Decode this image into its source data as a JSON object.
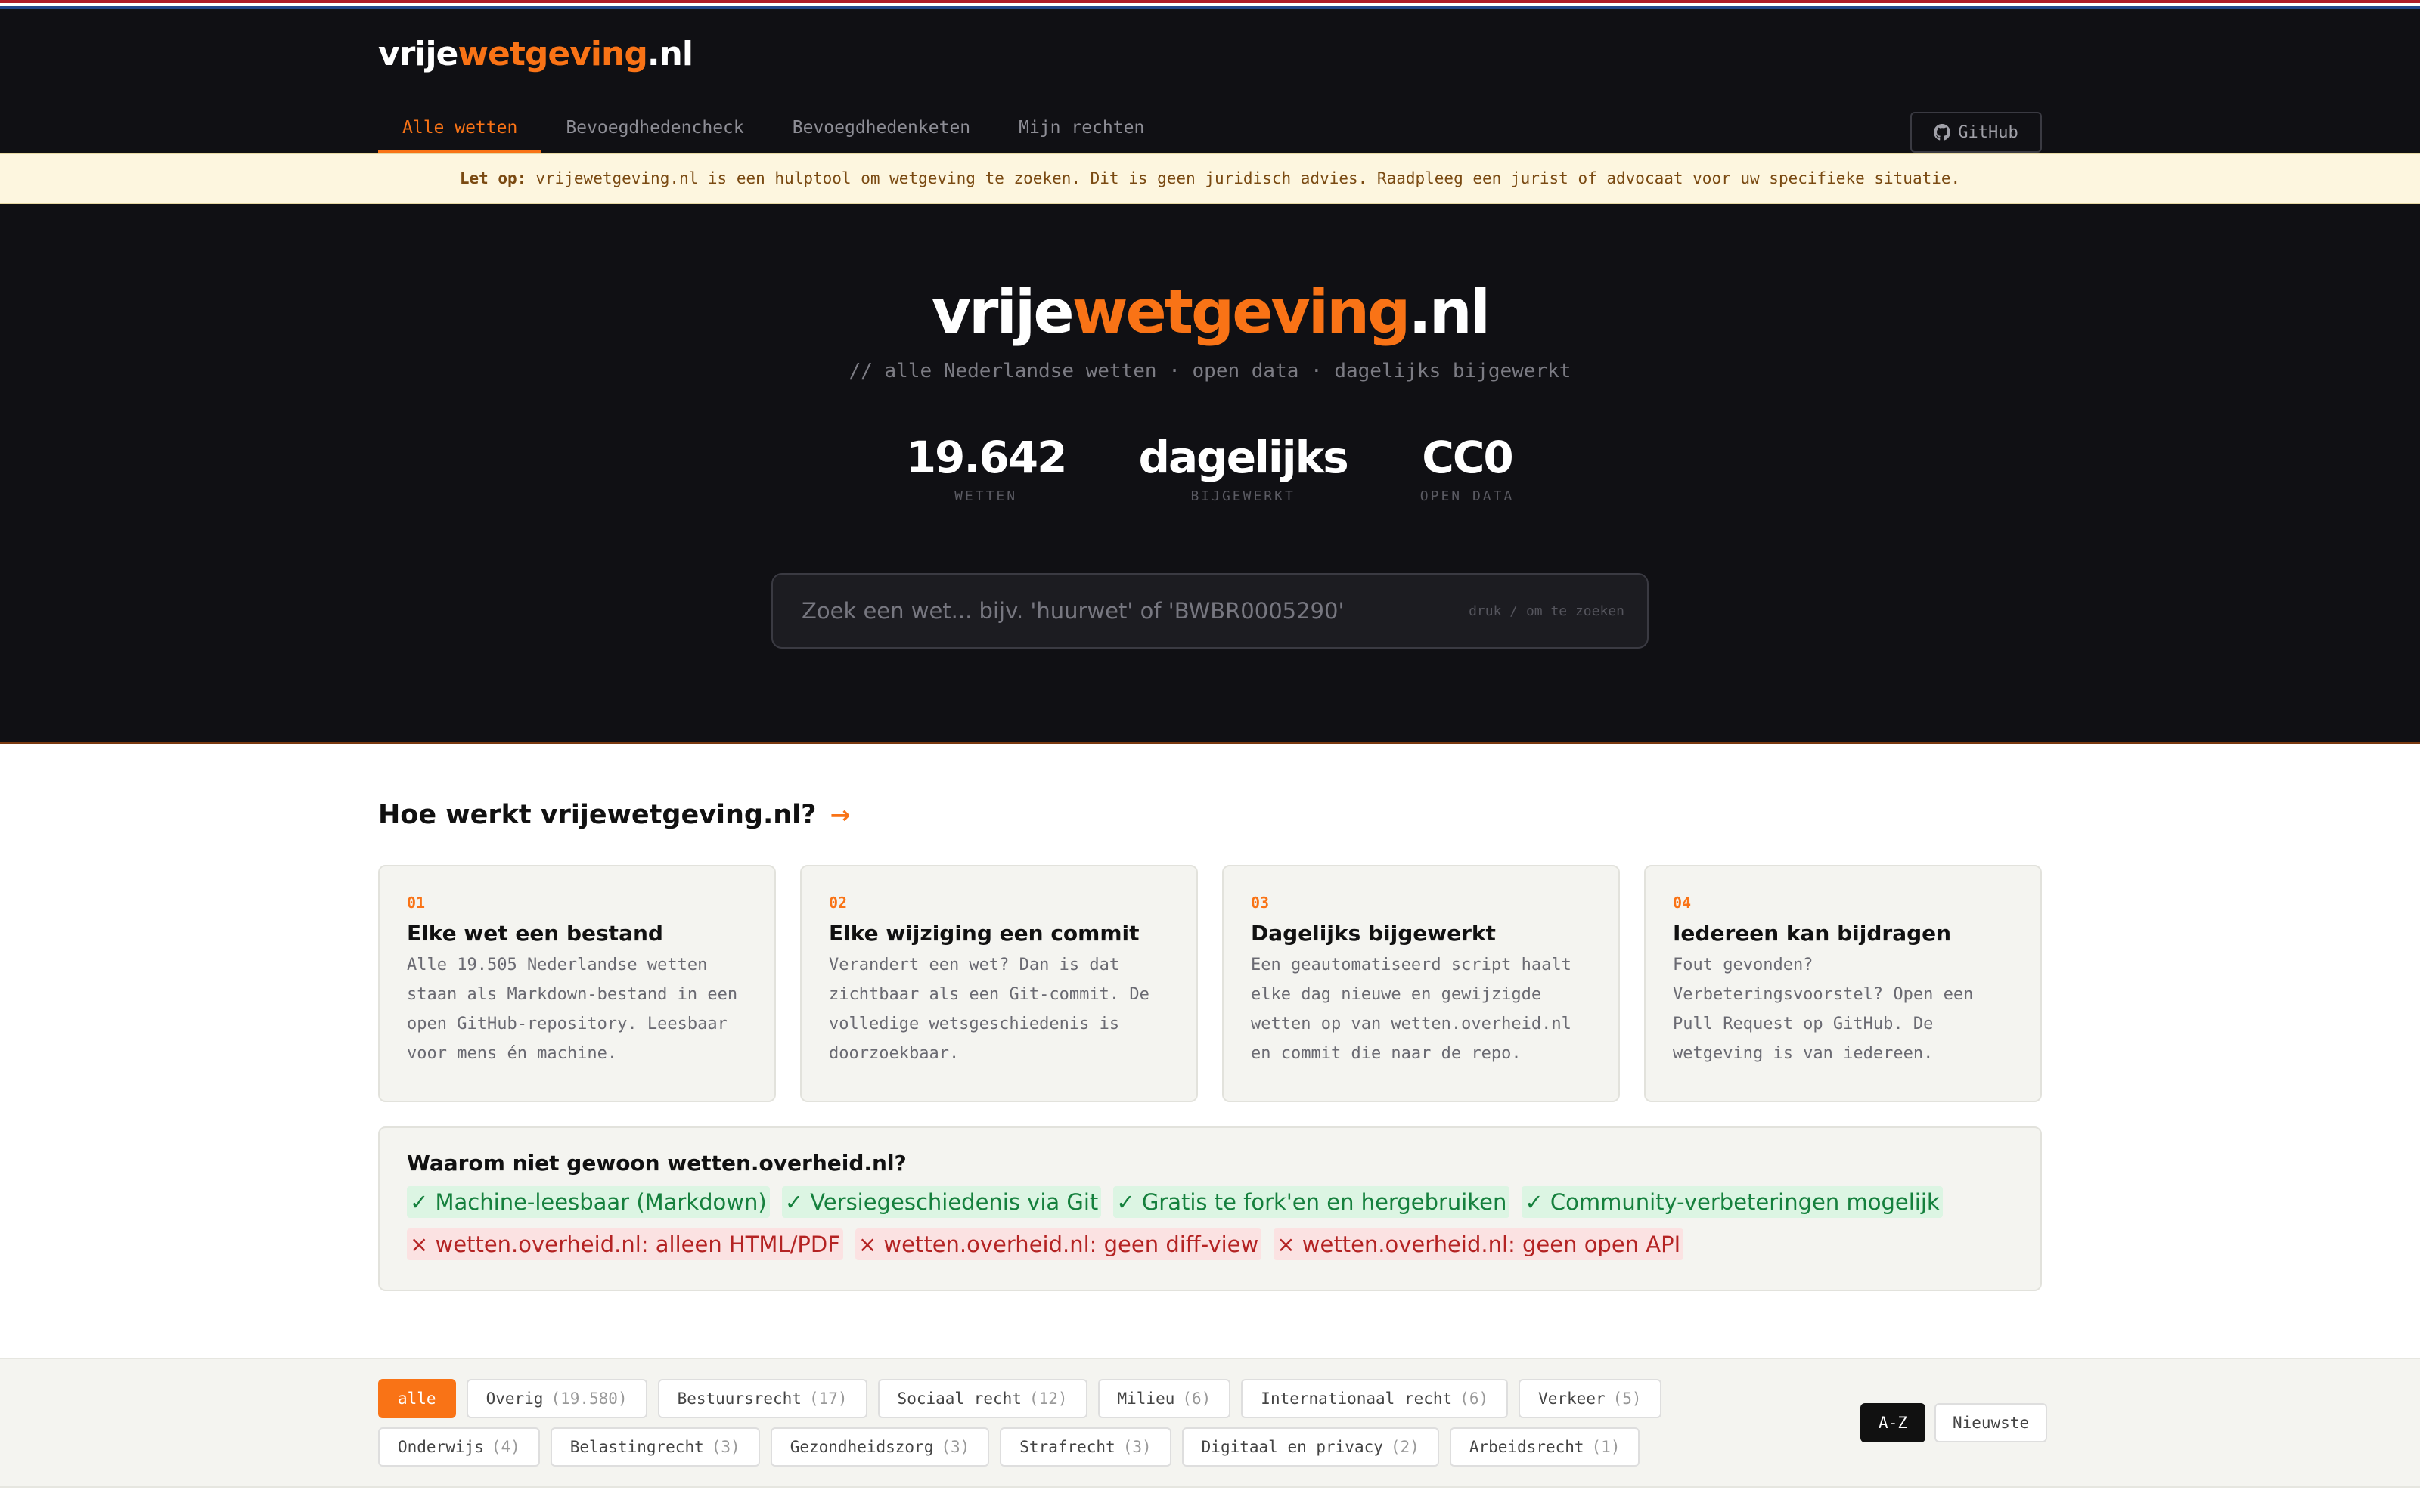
{
  "brand": {
    "prefix": "vrije",
    "accent": "wetgeving",
    "suffix": ".nl"
  },
  "nav": {
    "tabs": [
      {
        "label": "Alle wetten",
        "active": true
      },
      {
        "label": "Bevoegdhedencheck",
        "active": false
      },
      {
        "label": "Bevoegdhedenketen",
        "active": false
      },
      {
        "label": "Mijn rechten",
        "active": false
      }
    ],
    "github_label": "GitHub"
  },
  "notice": {
    "label": "Let op:",
    "text": "vrijewetgeving.nl is een hulptool om wetgeving te zoeken. Dit is geen juridisch advies. Raadpleeg een jurist of advocaat voor uw specifieke situatie."
  },
  "hero": {
    "subtitle": "// alle Nederlandse wetten · open data · dagelijks bijgewerkt",
    "stats": [
      {
        "value": "19.642",
        "label": "wetten"
      },
      {
        "value": "dagelijks",
        "label": "bijgewerkt"
      },
      {
        "value": "CC0",
        "label": "open data"
      }
    ],
    "search": {
      "placeholder": "Zoek een wet... bijv. 'huurwet' of 'BWBR0005290'",
      "hint": "druk / om te zoeken"
    }
  },
  "how": {
    "title": "Hoe werkt vrijewetgeving.nl?",
    "arrow": "→",
    "cards": [
      {
        "num": "01",
        "title": "Elke wet een bestand",
        "body": "Alle 19.505 Nederlandse wetten staan als Markdown-bestand in een open GitHub-repository. Leesbaar voor mens én machine."
      },
      {
        "num": "02",
        "title": "Elke wijziging een commit",
        "body": "Verandert een wet? Dan is dat zichtbaar als een Git-commit. De volledige wetsgeschiedenis is doorzoekbaar."
      },
      {
        "num": "03",
        "title": "Dagelijks bijgewerkt",
        "body": "Een geautomatiseerd script haalt elke dag nieuwe en gewijzigde wetten op van wetten.overheid.nl en commit die naar de repo."
      },
      {
        "num": "04",
        "title": "Iedereen kan bijdragen",
        "body": "Fout gevonden? Verbeteringsvoorstel? Open een Pull Request op GitHub. De wetgeving is van iedereen."
      }
    ]
  },
  "why": {
    "title": "Waarom niet gewoon wetten.overheid.nl?",
    "pros": [
      "✓ Machine-leesbaar (Markdown)",
      "✓ Versiegeschiedenis via Git",
      "✓ Gratis te fork'en en hergebruiken",
      "✓ Community-verbeteringen mogelijk"
    ],
    "cons": [
      "× wetten.overheid.nl: alleen HTML/PDF",
      "× wetten.overheid.nl: geen diff-view",
      "× wetten.overheid.nl: geen open API"
    ]
  },
  "filters": {
    "categories": [
      {
        "label": "alle",
        "count": "",
        "active": true
      },
      {
        "label": "Overig",
        "count": "(19.580)",
        "active": false
      },
      {
        "label": "Bestuursrecht",
        "count": "(17)",
        "active": false
      },
      {
        "label": "Sociaal recht",
        "count": "(12)",
        "active": false
      },
      {
        "label": "Milieu",
        "count": "(6)",
        "active": false
      },
      {
        "label": "Internationaal recht",
        "count": "(6)",
        "active": false
      },
      {
        "label": "Verkeer",
        "count": "(5)",
        "active": false
      },
      {
        "label": "Onderwijs",
        "count": "(4)",
        "active": false
      },
      {
        "label": "Belastingrecht",
        "count": "(3)",
        "active": false
      },
      {
        "label": "Gezondheidszorg",
        "count": "(3)",
        "active": false
      },
      {
        "label": "Strafrecht",
        "count": "(3)",
        "active": false
      },
      {
        "label": "Digitaal en privacy",
        "count": "(2)",
        "active": false
      },
      {
        "label": "Arbeidsrecht",
        "count": "(1)",
        "active": false
      }
    ],
    "sort": [
      {
        "label": "A-Z",
        "active": true
      },
      {
        "label": "Nieuwste",
        "active": false
      }
    ]
  },
  "colors": {
    "accent": "#f97316",
    "dark_bg": "#101014",
    "notice_bg": "#fdf6df"
  }
}
